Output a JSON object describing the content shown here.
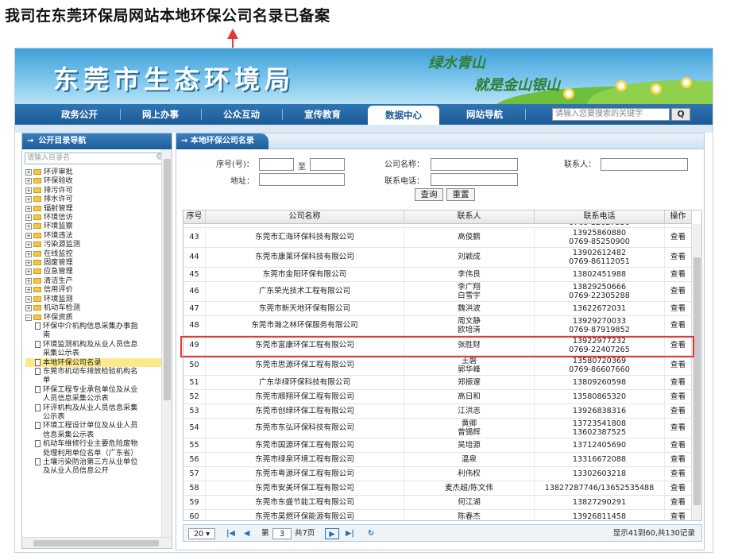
{
  "caption": "我司在东莞环保局网站本地环保公司名录已备案",
  "banner": {
    "title": "东莞市生态环境局",
    "slogan1": "绿水青山",
    "slogan2": "就是金山银山"
  },
  "nav": {
    "items": [
      "政务公开",
      "网上办事",
      "公众互动",
      "宣传教育",
      "数据中心",
      "网站导航"
    ],
    "active": "数据中心",
    "search_placeholder": "请输入您要搜索的关键字",
    "search_icon": "Q"
  },
  "sidebar": {
    "title": "公开目录导航",
    "search_placeholder": "请输入目录名",
    "nodes": [
      "环评审批",
      "环保验收",
      "排污许可",
      "排水许可",
      "辐射管理",
      "环境信访",
      "环境监察",
      "环境违法",
      "污染源监测",
      "在线监控",
      "固废管理",
      "应急管理",
      "清洁生产",
      "信用评价",
      "环境监测",
      "机动车检测"
    ],
    "expanded": "环保资质",
    "children": [
      "环保中介机构信息采集办事指南",
      "环境监测机构及从业人员信息采集公示表",
      "本地环保公司名录",
      "东莞市机动车排放检验机构名单",
      "环保工程专业承包单位及从业人员信息采集公示表",
      "环评机构及从业人员信息采集公示表",
      "环境工程设计单位及从业人员信息采集公示表",
      "机动车维修行业主要危险废物处理利用单位名单（广东省）",
      "土壤污染防治第三方从业单位及从业人员信息公开"
    ],
    "selected": "本地环保公司名录"
  },
  "main": {
    "tab": "本地环保公司名录",
    "form": {
      "seq_label": "序号(号)：",
      "to_label": "至",
      "company_label": "公司名称：",
      "contact_label": "联系人：",
      "address_label": "地址：",
      "phone_label": "联系电话：",
      "query_button": "查询",
      "reset_button": "重置"
    },
    "columns": [
      "序号",
      "公司名称",
      "联系人",
      "联系电话",
      "操作"
    ],
    "partial_top_phone": "0769-22627550",
    "rows": [
      {
        "no": "43",
        "name": "东莞市汇海环保科技有限公司",
        "contact": "高俊鹏",
        "phone": "13925860880\n0769-85250900",
        "op": "查看"
      },
      {
        "no": "44",
        "name": "东莞市康莱环保科技有限公司",
        "contact": "刘颖成",
        "phone": "13902612482\n0769-86112051",
        "op": "查看"
      },
      {
        "no": "45",
        "name": "东莞市金阳环保有限公司",
        "contact": "李伟良",
        "phone": "13802451988",
        "op": "查看"
      },
      {
        "no": "46",
        "name": "广东荣光技术工程有限公司",
        "contact": "李广翔\n白雪宇",
        "phone": "13829250666\n0769-22305288",
        "op": "查看"
      },
      {
        "no": "47",
        "name": "东莞市新天地环保有限公司",
        "contact": "魏洪波",
        "phone": "13622672031",
        "op": "查看"
      },
      {
        "no": "48",
        "name": "东莞市瀚之林环保服务有限公司",
        "contact": "周文静\n欧培清",
        "phone": "13929270033\n0769-87919852",
        "op": "查看"
      },
      {
        "no": "49",
        "name": "东莞市富康环保工程有限公司",
        "contact": "张胜财",
        "phone": "13922977232\n0769-22407265",
        "op": "查看"
      },
      {
        "no": "50",
        "name": "东莞市思源环保工程有限公司",
        "contact": "王磐\n郭华峰",
        "phone": "13580720369\n0769-86607660",
        "op": "查看"
      },
      {
        "no": "51",
        "name": "广东华绿环保科技有限公司",
        "contact": "郑振邃",
        "phone": "13809260598",
        "op": "查看"
      },
      {
        "no": "52",
        "name": "东莞市顺翔环保工程有限公司",
        "contact": "高日和",
        "phone": "13580865320",
        "op": "查看"
      },
      {
        "no": "53",
        "name": "东莞市创绿环保工程有限公司",
        "contact": "江洪志",
        "phone": "13926838316",
        "op": "查看"
      },
      {
        "no": "54",
        "name": "东莞市东弘环保科技有限公司",
        "contact": "黄卿\n曾锡辉",
        "phone": "13723541808\n13602387525",
        "op": "查看"
      },
      {
        "no": "55",
        "name": "东莞市国源环保工程有限公司",
        "contact": "吴培源",
        "phone": "13712405690",
        "op": "查看"
      },
      {
        "no": "56",
        "name": "东莞市绿泉环境工程有限公司",
        "contact": "温泉",
        "phone": "13316672088",
        "op": "查看"
      },
      {
        "no": "57",
        "name": "东莞市粤源环保工程有限公司",
        "contact": "利伟权",
        "phone": "13302603218",
        "op": "查看"
      },
      {
        "no": "58",
        "name": "东莞市安美环保工程有限公司",
        "contact": "麦杰超/陈文伟",
        "phone": "13827287746/13652535488",
        "op": "查看"
      },
      {
        "no": "59",
        "name": "东莞市东盛节能工程有限公司",
        "contact": "何江湖",
        "phone": "13827290291",
        "op": "查看"
      },
      {
        "no": "60",
        "name": "东莞市昊燃环保能源有限公司",
        "contact": "陈春杰",
        "phone": "13926811458",
        "op": "查看"
      }
    ],
    "pager": {
      "page_size": "20",
      "page_label": "第",
      "page": "3",
      "total_pages": "共7页",
      "summary": "显示41到60,共130记录"
    }
  },
  "colors": {
    "highlight": "#e53935",
    "nav": "#1c5a95",
    "accent": "#3a7fbf"
  }
}
